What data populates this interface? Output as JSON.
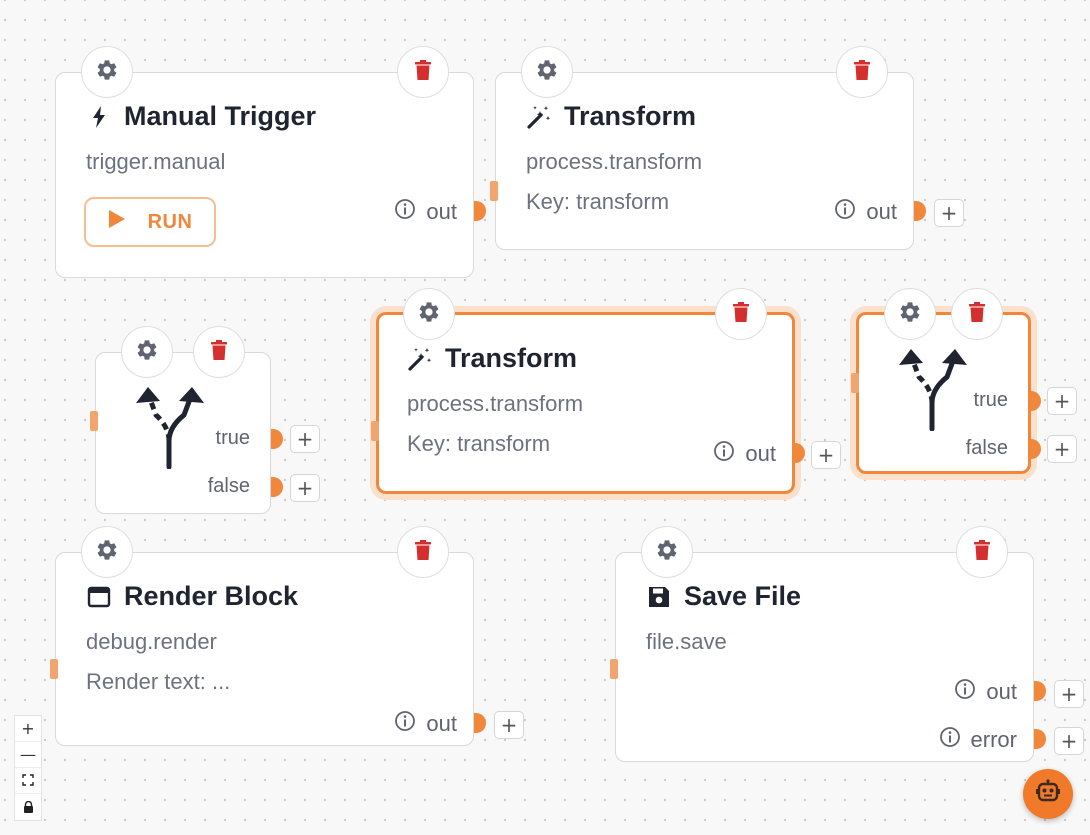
{
  "nodes": {
    "manual_trigger": {
      "title": "Manual Trigger",
      "type": "trigger.manual",
      "run_label": "RUN",
      "out_label": "out"
    },
    "transform_top": {
      "title": "Transform",
      "type": "process.transform",
      "detail": "Key: transform",
      "out_label": "out"
    },
    "condition_left": {
      "true_label": "true",
      "false_label": "false"
    },
    "transform_mid": {
      "title": "Transform",
      "type": "process.transform",
      "detail": "Key: transform",
      "out_label": "out"
    },
    "condition_right": {
      "true_label": "true",
      "false_label": "false"
    },
    "render_block": {
      "title": "Render Block",
      "type": "debug.render",
      "detail": "Render text: ...",
      "out_label": "out"
    },
    "save_file": {
      "title": "Save File",
      "type": "file.save",
      "out_label": "out",
      "error_label": "error"
    }
  },
  "controls": {
    "plus": "+",
    "zoom_in": "+",
    "zoom_out": "—"
  },
  "colors": {
    "accent": "#f0873a",
    "delete": "#d32f2f",
    "gear": "#5f6470"
  },
  "icons": [
    "gear-icon",
    "trash-icon",
    "bolt-icon",
    "magic-wand-icon",
    "branch-icon",
    "window-icon",
    "floppy-disk-icon",
    "info-icon",
    "play-icon",
    "robot-icon",
    "fit-view-icon",
    "lock-icon"
  ]
}
